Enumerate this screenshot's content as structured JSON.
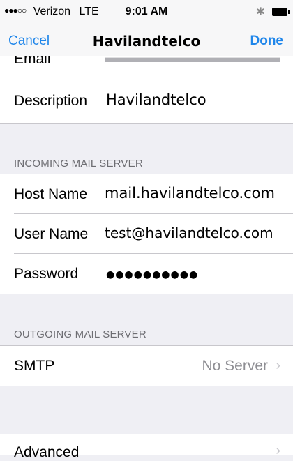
{
  "status_bar": {
    "signal": "●●●○○",
    "carrier": "Verizon",
    "network": "LTE",
    "time": "9:01 AM",
    "bluetooth_glyph": "✱"
  },
  "nav": {
    "cancel": "Cancel",
    "title": "Havilandtelco",
    "done": "Done"
  },
  "account": {
    "email_label": "Email",
    "description_label": "Description",
    "description_value": "Havilandtelco"
  },
  "incoming": {
    "header": "INCOMING MAIL SERVER",
    "host_label": "Host Name",
    "host_value": "mail.havilandtelco.com",
    "user_label": "User Name",
    "user_value": "test@havilandtelco.com",
    "password_label": "Password",
    "password_value": "●●●●●●●●●●"
  },
  "outgoing": {
    "header": "OUTGOING MAIL SERVER",
    "smtp_label": "SMTP",
    "smtp_value": "No Server"
  },
  "advanced": {
    "label": "Advanced"
  },
  "colors": {
    "accent": "#1f86ea",
    "background": "#efeff4",
    "separator": "#c8c7cc",
    "secondary_text": "#8e8e93"
  }
}
